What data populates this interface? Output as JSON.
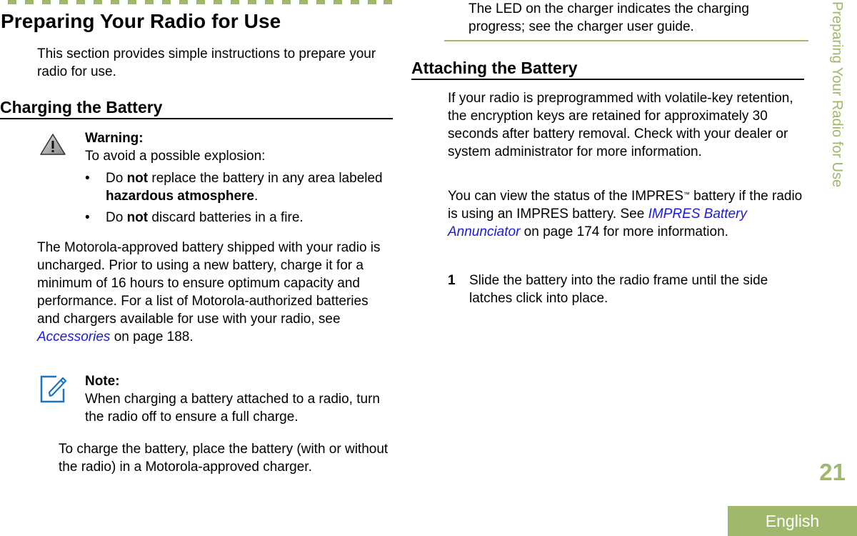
{
  "page": {
    "section_title": "Preparing Your Radio for Use",
    "side_title": "Preparing Your Radio for Use",
    "page_number": "21",
    "language": "English",
    "accent_color": "#9fb86b",
    "link_color": "#1a1adb"
  },
  "intro": "This section provides simple instructions to prepare your radio for use.",
  "charging": {
    "heading": "Charging the Battery",
    "warning": {
      "icon": "warning-triangle-icon",
      "title": "Warning:",
      "text": "To avoid a possible explosion:",
      "bullets": [
        {
          "pre": "Do ",
          "bold": "not",
          "post": " replace the battery in any area labeled ",
          "bold2": "hazardous atmosphere",
          "post2": "."
        },
        {
          "pre": "Do ",
          "bold": "not",
          "post": " discard batteries in a fire."
        }
      ],
      "bullet_char": "•"
    },
    "body": {
      "text_before_link": "The Motorola-approved battery shipped with your radio is uncharged. Prior to using a new battery, charge it for a minimum of 16 hours to ensure optimum capacity and performance. For a list of Motorola-authorized batteries and chargers available for use with your radio, see ",
      "link": "Accessories",
      "text_after_link": " on page 188."
    },
    "note": {
      "icon": "note-pencil-icon",
      "title": "Note:",
      "text": "When charging a battery attached to a radio, turn the radio off to ensure a full charge."
    },
    "instruction": "To charge the battery, place the battery (with or without the radio) in a Motorola-approved charger.",
    "led_text": "The LED on the charger indicates the charging progress; see the charger user guide."
  },
  "attaching": {
    "heading": "Attaching the Battery",
    "para1": "If your radio is preprogrammed with volatile-key retention, the encryption keys are retained for approximately 30 seconds after battery removal. Check with your dealer or system administrator for more information.",
    "para2": {
      "text1": "You can view the status of the IMPRES",
      "tm": "™",
      "text2": " battery if the radio is using an IMPRES battery. See ",
      "link": "IMPRES Battery Annunciator",
      "text3": " on page 174 for more information."
    },
    "steps": [
      {
        "number": "1",
        "text": "Slide the battery into the radio frame until the side latches click into place."
      }
    ]
  }
}
